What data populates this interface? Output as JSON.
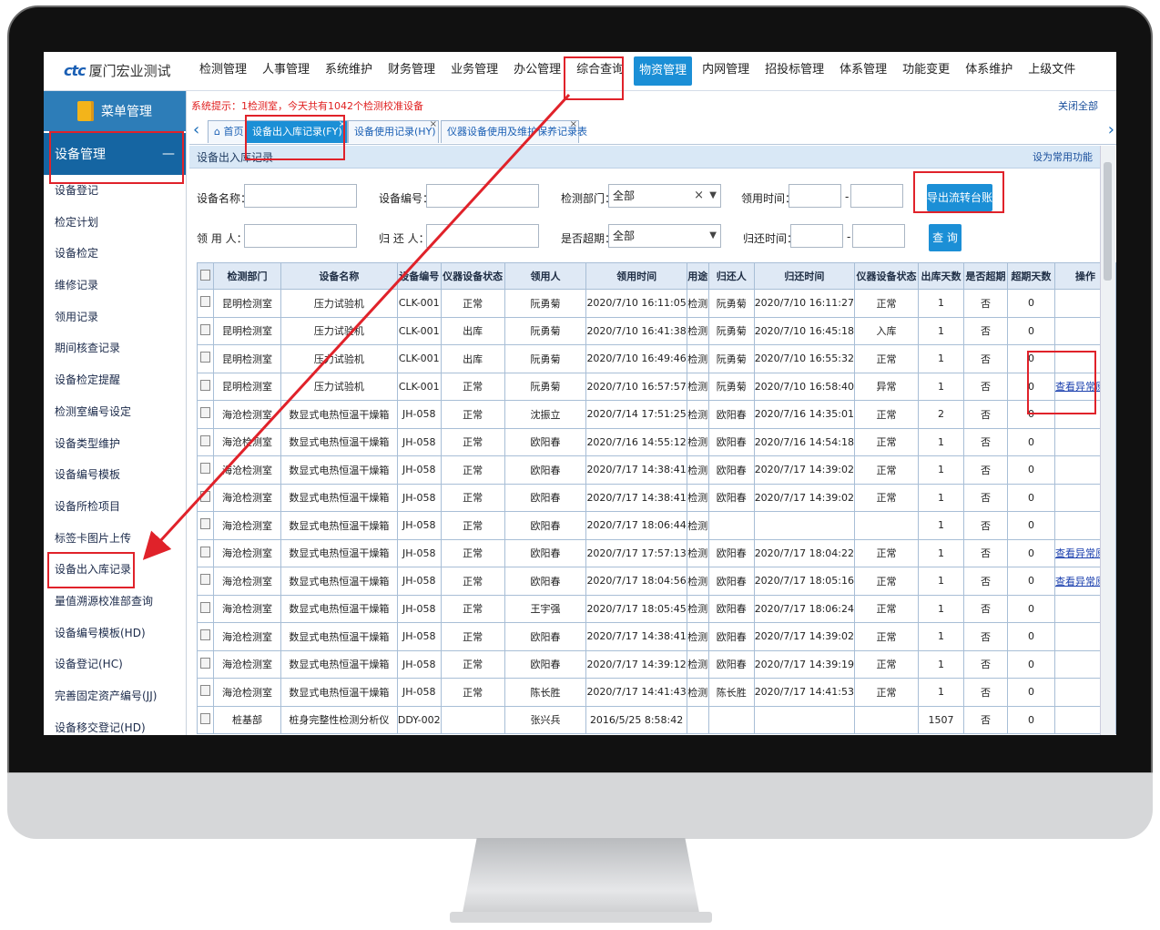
{
  "app": {
    "logo_mark": "ctc",
    "logo_name": "厦门宏业测试"
  },
  "topnav": [
    {
      "label": "检测管理",
      "active": false
    },
    {
      "label": "人事管理",
      "active": false
    },
    {
      "label": "系统维护",
      "active": false
    },
    {
      "label": "财务管理",
      "active": false
    },
    {
      "label": "业务管理",
      "active": false
    },
    {
      "label": "办公管理",
      "active": false
    },
    {
      "label": "综合查询",
      "active": false
    },
    {
      "label": "物资管理",
      "active": true
    },
    {
      "label": "内网管理",
      "active": false
    },
    {
      "label": "招投标管理",
      "active": false
    },
    {
      "label": "体系管理",
      "active": false
    },
    {
      "label": "功能变更",
      "active": false
    },
    {
      "label": "体系维护",
      "active": false
    },
    {
      "label": "上级文件",
      "active": false
    }
  ],
  "sidebar": {
    "header": "菜单管理",
    "group": "设备管理",
    "group_toggle": "—",
    "items": [
      "设备登记",
      "检定计划",
      "设备检定",
      "维修记录",
      "领用记录",
      "期间核查记录",
      "设备检定提醒",
      "检测室编号设定",
      "设备类型维护",
      "设备编号模板",
      "设备所检项目",
      "标签卡图片上传",
      "设备出入库记录",
      "量值溯源校准部查询",
      "设备编号模板(HD)",
      "设备登记(HC)",
      "完善固定资产编号(JJ)",
      "设备移交登记(HD)"
    ]
  },
  "main": {
    "system_msg": "系统提示：1检测室，今天共有1042个检测校准设备",
    "close_all": "关闭全部",
    "tabs": [
      {
        "label": "首页",
        "active": false
      },
      {
        "label": "设备出入库记录(FY)",
        "active": true,
        "close": "×"
      },
      {
        "label": "设备使用记录(HY)",
        "active": false,
        "close": "×"
      },
      {
        "label": "仪器设备使用及维护保养记录表",
        "active": false,
        "close": "×"
      }
    ],
    "panel_title": "设备出入库记录",
    "panel_right": "设为常用功能",
    "form": {
      "name_label": "设备名称：",
      "code_label": "设备编号：",
      "dept_label": "检测部门：",
      "dept_value": "全部",
      "borrow_time_label": "领用时间：",
      "dash": "-",
      "export_button": "导出流转台账",
      "borrower_label": "领 用 人：",
      "returner_label": "归 还 人：",
      "overdue_label": "是否超期：",
      "overdue_value": "全部",
      "return_time_label": "归还时间：",
      "query_button": "查 询",
      "clear_x": "×",
      "select_arrow": "▼"
    },
    "table": {
      "headers": [
        "检测部门",
        "设备名称",
        "设备编号",
        "仪器设备状态",
        "领用人",
        "领用时间",
        "用途",
        "归还人",
        "归还时间",
        "仪器设备状态",
        "出库天数",
        "是否超期",
        "超期天数",
        "操作"
      ],
      "rows": [
        [
          "昆明检测室",
          "压力试验机",
          "CLK-001",
          "正常",
          "阮勇菊",
          "2020/7/10 16:11:05",
          "检测",
          "阮勇菊",
          "2020/7/10 16:11:27",
          "正常",
          "1",
          "否",
          "0",
          ""
        ],
        [
          "昆明检测室",
          "压力试验机",
          "CLK-001",
          "出库",
          "阮勇菊",
          "2020/7/10 16:41:38",
          "检测",
          "阮勇菊",
          "2020/7/10 16:45:18",
          "入库",
          "1",
          "否",
          "0",
          ""
        ],
        [
          "昆明检测室",
          "压力试验机",
          "CLK-001",
          "出库",
          "阮勇菊",
          "2020/7/10 16:49:46",
          "检测",
          "阮勇菊",
          "2020/7/10 16:55:32",
          "正常",
          "1",
          "否",
          "0",
          ""
        ],
        [
          "昆明检测室",
          "压力试验机",
          "CLK-001",
          "正常",
          "阮勇菊",
          "2020/7/10 16:57:57",
          "检测",
          "阮勇菊",
          "2020/7/10 16:58:40",
          "异常",
          "1",
          "否",
          "0",
          "查看异常原因"
        ],
        [
          "海沧检测室",
          "数显式电热恒温干燥箱",
          "JH-058",
          "正常",
          "沈振立",
          "2020/7/14 17:51:25",
          "检测",
          "欧阳春",
          "2020/7/16 14:35:01",
          "正常",
          "2",
          "否",
          "0",
          ""
        ],
        [
          "海沧检测室",
          "数显式电热恒温干燥箱",
          "JH-058",
          "正常",
          "欧阳春",
          "2020/7/16 14:55:12",
          "检测",
          "欧阳春",
          "2020/7/16 14:54:18",
          "正常",
          "1",
          "否",
          "0",
          ""
        ],
        [
          "海沧检测室",
          "数显式电热恒温干燥箱",
          "JH-058",
          "正常",
          "欧阳春",
          "2020/7/17 14:38:41",
          "检测",
          "欧阳春",
          "2020/7/17 14:39:02",
          "正常",
          "1",
          "否",
          "0",
          ""
        ],
        [
          "海沧检测室",
          "数显式电热恒温干燥箱",
          "JH-058",
          "正常",
          "欧阳春",
          "2020/7/17 14:38:41",
          "检测",
          "欧阳春",
          "2020/7/17 14:39:02",
          "正常",
          "1",
          "否",
          "0",
          ""
        ],
        [
          "海沧检测室",
          "数显式电热恒温干燥箱",
          "JH-058",
          "正常",
          "欧阳春",
          "2020/7/17 18:06:44",
          "检测",
          "",
          "",
          "",
          "1",
          "否",
          "0",
          ""
        ],
        [
          "海沧检测室",
          "数显式电热恒温干燥箱",
          "JH-058",
          "正常",
          "欧阳春",
          "2020/7/17 17:57:13",
          "检测",
          "欧阳春",
          "2020/7/17 18:04:22",
          "正常",
          "1",
          "否",
          "0",
          "查看异常原因"
        ],
        [
          "海沧检测室",
          "数显式电热恒温干燥箱",
          "JH-058",
          "正常",
          "欧阳春",
          "2020/7/17 18:04:56",
          "检测",
          "欧阳春",
          "2020/7/17 18:05:16",
          "正常",
          "1",
          "否",
          "0",
          "查看异常原因"
        ],
        [
          "海沧检测室",
          "数显式电热恒温干燥箱",
          "JH-058",
          "正常",
          "王宇强",
          "2020/7/17 18:05:45",
          "检测",
          "欧阳春",
          "2020/7/17 18:06:24",
          "正常",
          "1",
          "否",
          "0",
          ""
        ],
        [
          "海沧检测室",
          "数显式电热恒温干燥箱",
          "JH-058",
          "正常",
          "欧阳春",
          "2020/7/17 14:38:41",
          "检测",
          "欧阳春",
          "2020/7/17 14:39:02",
          "正常",
          "1",
          "否",
          "0",
          ""
        ],
        [
          "海沧检测室",
          "数显式电热恒温干燥箱",
          "JH-058",
          "正常",
          "欧阳春",
          "2020/7/17 14:39:12",
          "检测",
          "欧阳春",
          "2020/7/17 14:39:19",
          "正常",
          "1",
          "否",
          "0",
          ""
        ],
        [
          "海沧检测室",
          "数显式电热恒温干燥箱",
          "JH-058",
          "正常",
          "陈长胜",
          "2020/7/17 14:41:43",
          "检测",
          "陈长胜",
          "2020/7/17 14:41:53",
          "正常",
          "1",
          "否",
          "0",
          ""
        ],
        [
          "桩基部",
          "桩身完整性检测分析仪",
          "DDY-002",
          "",
          "张兴兵",
          "2016/5/25 8:58:42",
          "",
          "",
          "",
          "",
          "1507",
          "否",
          "0",
          ""
        ]
      ]
    }
  },
  "colors": {
    "accent": "#1b8fd6",
    "highlight": "#e0222a",
    "sidebar_group": "#1565a2"
  }
}
